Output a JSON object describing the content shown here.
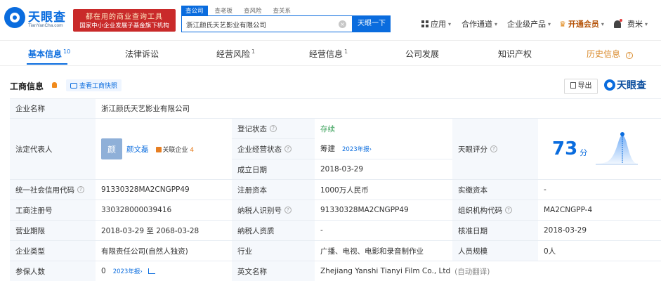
{
  "header": {
    "logo_text": "天眼查",
    "logo_sub": "TianYanCha.com",
    "promo_line1": "都在用的商业查询工具",
    "promo_line2": "国家中小企业发展子基金旗下机构",
    "search_tabs": [
      "查公司",
      "查老板",
      "查风险",
      "查关系"
    ],
    "search_value": "浙江颜氏天艺影业有限公司",
    "search_button": "天眼一下",
    "nav": {
      "app": "应用",
      "channel": "合作通道",
      "enterprise": "企业级产品",
      "vip": "开通会员",
      "user": "费米"
    }
  },
  "tabs": [
    {
      "label": "基本信息",
      "count": "10"
    },
    {
      "label": "法律诉讼",
      "count": ""
    },
    {
      "label": "经营风险",
      "count": "1"
    },
    {
      "label": "经营信息",
      "count": "1"
    },
    {
      "label": "公司发展",
      "count": ""
    },
    {
      "label": "知识产权",
      "count": ""
    },
    {
      "label": "历史信息",
      "count": ""
    }
  ],
  "section": {
    "title": "工商信息",
    "snapshot": "查看工商快照",
    "export": "导出",
    "brand": "天眼查"
  },
  "info": {
    "company_name_label": "企业名称",
    "company_name": "浙江颜氏天艺影业有限公司",
    "legal_rep_label": "法定代表人",
    "legal_rep_avatar": "颜",
    "legal_rep_name": "颜文磊",
    "related_label": "关联企业",
    "related_count": "4",
    "reg_status_label": "登记状态",
    "reg_status": "存续",
    "biz_status_label": "企业经营状态",
    "biz_status": "筹建",
    "biz_status_year": "2023年报",
    "founded_label": "成立日期",
    "founded": "2018-03-29",
    "score_label": "天眼评分",
    "score": "73",
    "score_unit": "分",
    "credit_code_label": "统一社会信用代码",
    "credit_code": "91330328MA2CNGPP49",
    "reg_capital_label": "注册资本",
    "reg_capital": "1000万人民币",
    "paid_capital_label": "实缴资本",
    "paid_capital": "-",
    "reg_no_label": "工商注册号",
    "reg_no": "330328000039416",
    "tax_id_label": "纳税人识别号",
    "tax_id": "91330328MA2CNGPP49",
    "org_code_label": "组织机构代码",
    "org_code": "MA2CNGPP-4",
    "term_label": "营业期限",
    "term": "2018-03-29 至 2068-03-28",
    "taxpayer_label": "纳税人资质",
    "taxpayer": "-",
    "approve_label": "核准日期",
    "approve": "2018-03-29",
    "type_label": "企业类型",
    "type": "有限责任公司(自然人独资)",
    "industry_label": "行业",
    "industry": "广播、电视、电影和录音制作业",
    "staff_label": "人员规模",
    "staff": "0人",
    "insured_label": "参保人数",
    "insured": "0",
    "insured_year": "2023年报",
    "en_name_label": "英文名称",
    "en_name": "Zhejiang Yanshi Tianyi Film Co., Ltd",
    "en_name_note": "(自动翻译)"
  },
  "colors": {
    "brand_blue": "#0a6cde",
    "promo_red": "#c92a2a",
    "history_orange": "#d98a2b",
    "status_green": "#3aa15a"
  }
}
